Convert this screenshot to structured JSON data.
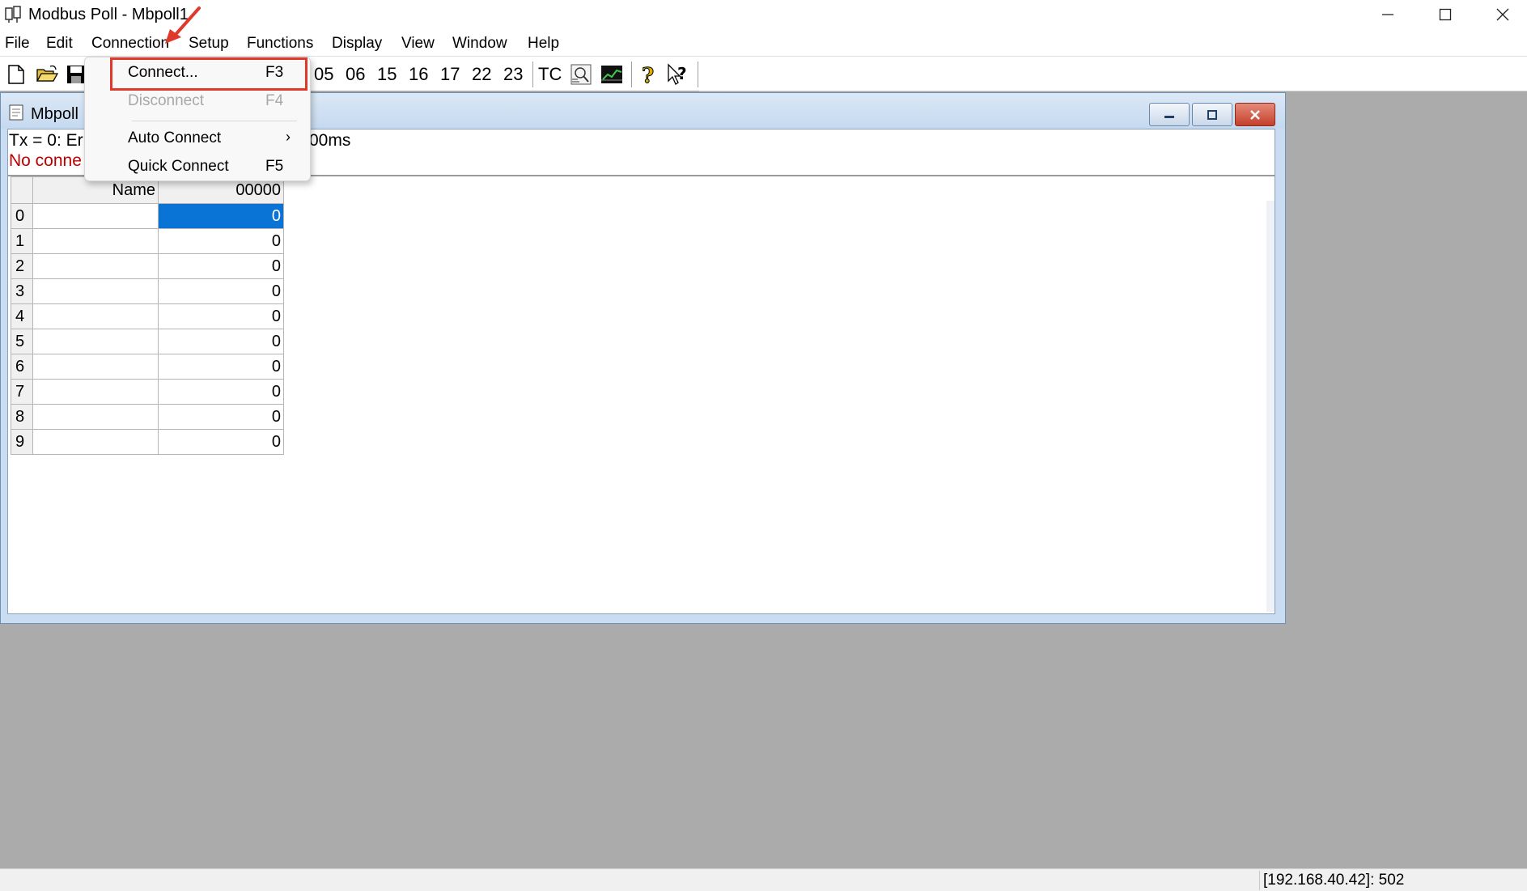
{
  "window": {
    "title": "Modbus Poll - Mbpoll1",
    "controls": {
      "minimize_icon": "minimize-icon",
      "maximize_icon": "maximize-icon",
      "close_icon": "close-icon"
    }
  },
  "menubar": {
    "items": [
      "File",
      "Edit",
      "Connection",
      "Setup",
      "Functions",
      "Display",
      "View",
      "Window",
      "Help"
    ]
  },
  "toolbar": {
    "function_codes": [
      "05",
      "06",
      "15",
      "16",
      "17",
      "22",
      "23"
    ],
    "tc_label": "TC",
    "icons": [
      "new-file-icon",
      "open-folder-icon",
      "save-icon",
      "communication-traffic-icon",
      "chart-icon",
      "help-icon",
      "context-help-icon"
    ]
  },
  "connection_menu": {
    "items": [
      {
        "label": "Connect...",
        "shortcut": "F3",
        "enabled": true,
        "highlighted": true
      },
      {
        "label": "Disconnect",
        "shortcut": "F4",
        "enabled": false
      },
      {
        "label": "Auto Connect",
        "shortcut": "",
        "submenu": true,
        "enabled": true
      },
      {
        "label": "Quick Connect",
        "shortcut": "F5",
        "enabled": true
      }
    ],
    "submenu_arrow": "›"
  },
  "child_window": {
    "title": "Mbpoll",
    "status_line_1": "Tx = 0: Er",
    "status_line_1_tail": "00ms",
    "status_line_2": "No conne",
    "grid": {
      "header_name": "Name",
      "header_address": "00000",
      "rows": [
        {
          "index": "0",
          "name": "",
          "value": "0",
          "selected": true
        },
        {
          "index": "1",
          "name": "",
          "value": "0"
        },
        {
          "index": "2",
          "name": "",
          "value": "0"
        },
        {
          "index": "3",
          "name": "",
          "value": "0"
        },
        {
          "index": "4",
          "name": "",
          "value": "0"
        },
        {
          "index": "5",
          "name": "",
          "value": "0"
        },
        {
          "index": "6",
          "name": "",
          "value": "0"
        },
        {
          "index": "7",
          "name": "",
          "value": "0"
        },
        {
          "index": "8",
          "name": "",
          "value": "0"
        },
        {
          "index": "9",
          "name": "",
          "value": "0"
        }
      ]
    }
  },
  "statusbar": {
    "address": "[192.168.40.42]: 502"
  },
  "colors": {
    "selection": "#0a74d6",
    "error_text": "#c00000",
    "highlight_box": "#e0382a",
    "mdi_background": "#ababab"
  }
}
